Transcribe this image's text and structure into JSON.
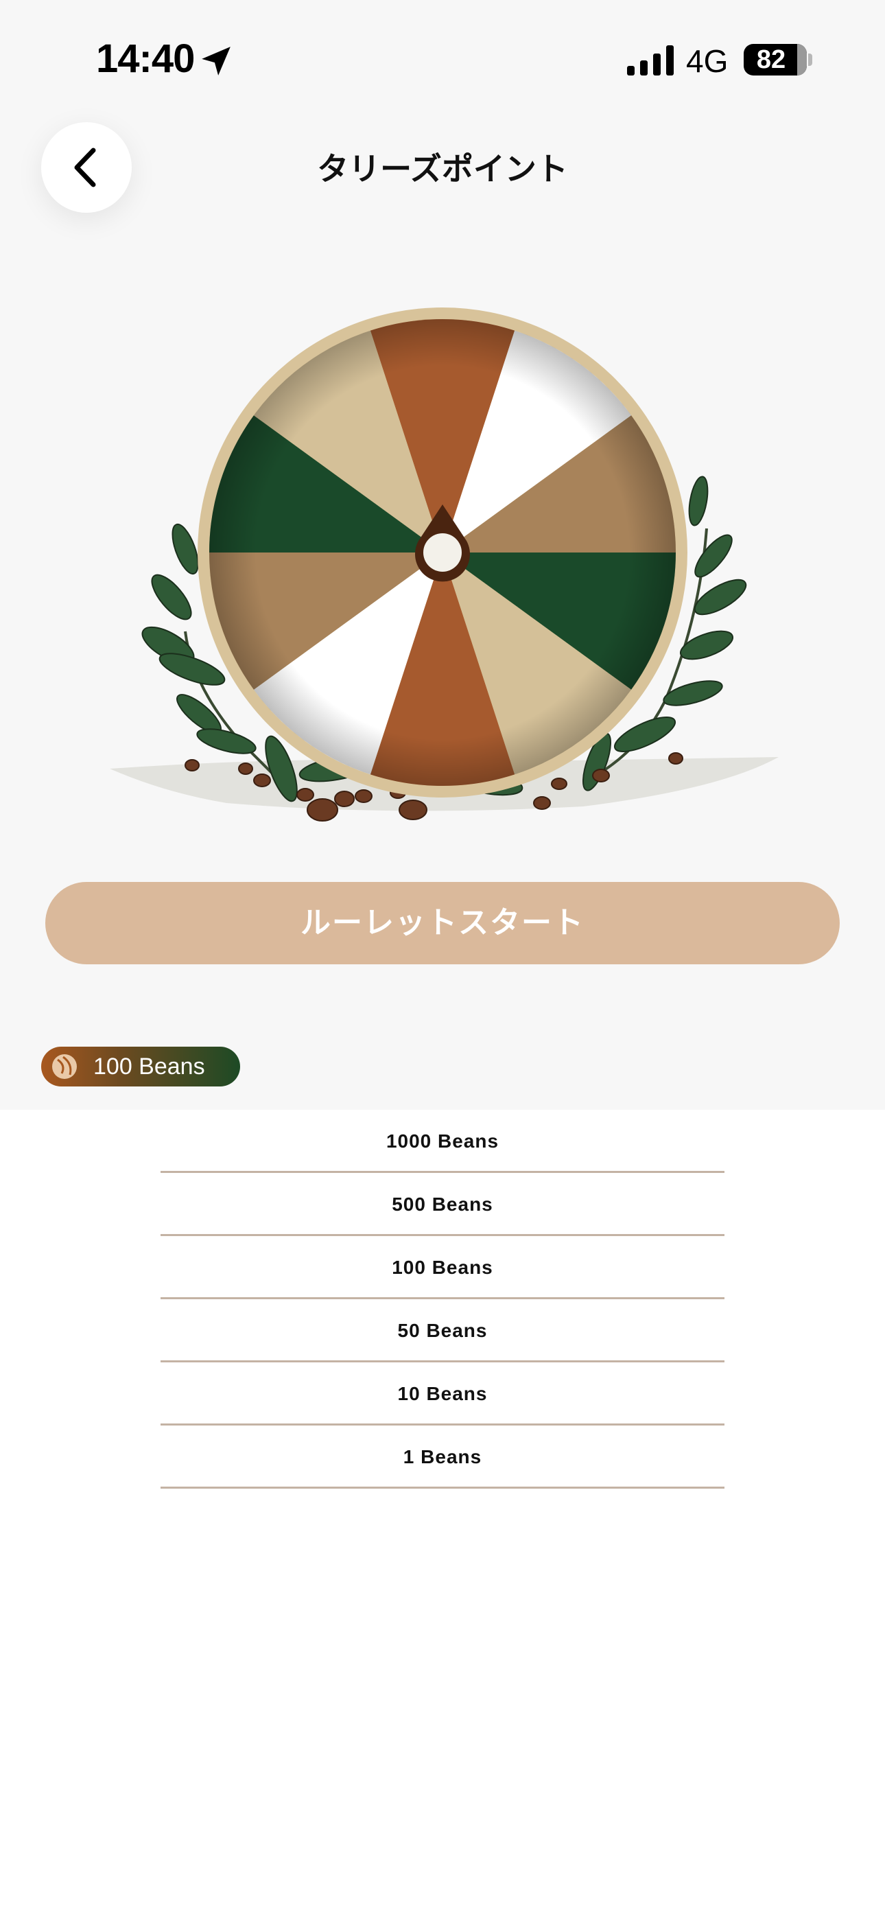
{
  "status_bar": {
    "time": "14:40",
    "network": "4G",
    "battery_level": "82",
    "icons": [
      "location-arrow-icon",
      "cellular-signal-icon",
      "battery-icon"
    ]
  },
  "header": {
    "title": "タリーズポイント",
    "back_icon": "chevron-left-icon"
  },
  "roulette": {
    "segment_colors": [
      "#a65a2e",
      "#ffffff",
      "#a8835a",
      "#1a4a2a",
      "#d4c098",
      "#a65a2e",
      "#ffffff",
      "#a8835a",
      "#1a4a2a",
      "#d4c098"
    ],
    "rim_color": "#d8c39a",
    "pointer_color": "#4a2410"
  },
  "start_button": {
    "label": "ルーレットスタート",
    "color": "#dab99b"
  },
  "balance": {
    "icon": "coffee-bean-icon",
    "text": "100 Beans"
  },
  "prizes": [
    {
      "label": "1000 Beans"
    },
    {
      "label": "500 Beans"
    },
    {
      "label": "100 Beans"
    },
    {
      "label": "50 Beans"
    },
    {
      "label": "10 Beans"
    },
    {
      "label": "1 Beans"
    }
  ]
}
